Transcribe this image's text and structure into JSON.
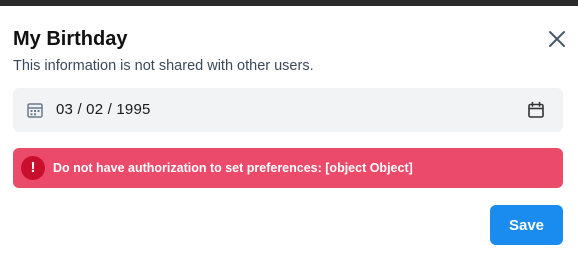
{
  "dialog": {
    "title": "My Birthday",
    "subtitle": "This information is not shared with other users.",
    "close_icon": "close-icon"
  },
  "date_field": {
    "value": "03 / 02 / 1995",
    "left_icon": "calendar-grid-icon",
    "right_icon": "calendar-icon"
  },
  "alert": {
    "icon": "exclamation-icon",
    "icon_glyph": "!",
    "message": "Do not have authorization to set preferences: [object Object]"
  },
  "actions": {
    "save_label": "Save"
  },
  "colors": {
    "alert_background": "#ec4a6b",
    "alert_icon": "#c8102e",
    "primary_button": "#1a8cf0",
    "field_background": "#f2f3f5"
  }
}
